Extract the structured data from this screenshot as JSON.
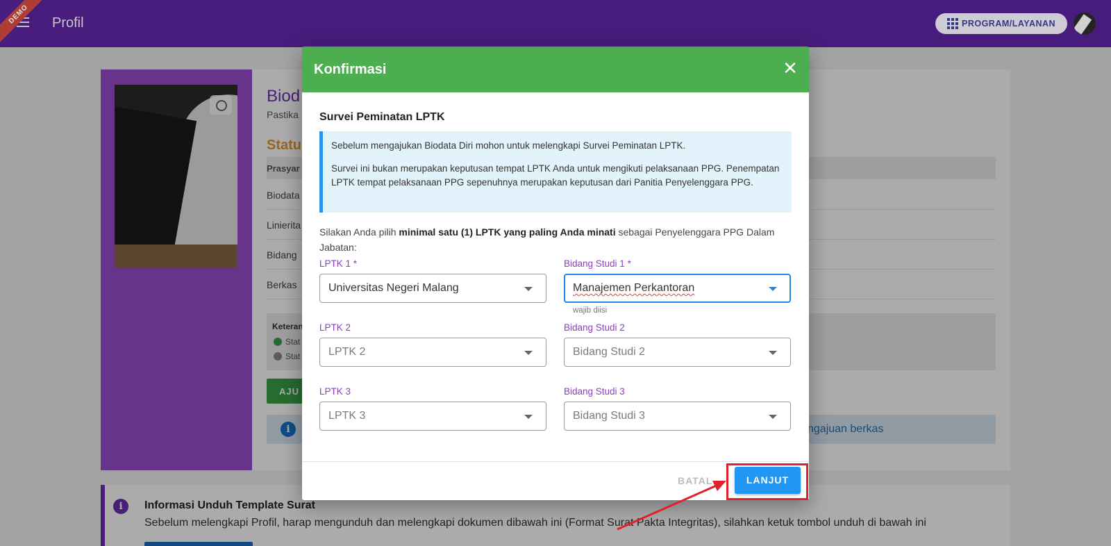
{
  "header": {
    "ribbon": "DEMO",
    "title": "Profil",
    "program_button": "PROGRAM/LAYANAN"
  },
  "background": {
    "title": "Biod",
    "subtitle": "Pastika",
    "status": "Statu",
    "table_header": "Prasyar",
    "rows": [
      "Biodata",
      "Linierita",
      "Bidang",
      "Berkas"
    ],
    "note_title": "Keteran",
    "note_lines": [
      "Stat",
      "Stat"
    ],
    "submit_button": "AJU",
    "info_link": "ngajuan berkas"
  },
  "info_card": {
    "title": "Informasi Unduh Template Surat",
    "text": "Sebelum melengkapi Profil, harap mengunduh dan melengkapi dokumen dibawah ini (Format Surat Pakta Integritas), silahkan ketuk tombol unduh di bawah ini"
  },
  "dialog": {
    "title": "Konfirmasi",
    "close_icon": "close-icon",
    "section_title": "Survei Peminatan LPTK",
    "alert_p1": "Sebelum mengajukan Biodata Diri mohon untuk melengkapi Survei Peminatan LPTK.",
    "alert_p2": "Survei ini bukan merupakan keputusan tempat LPTK Anda untuk mengikuti pelaksanaan PPG. Penempatan LPTK tempat pelaksanaan PPG sepenuhnya merupakan keputusan dari Panitia Penyelenggara PPG.",
    "instruction_pre": "Silakan Anda pilih ",
    "instruction_bold": "minimal satu (1) LPTK yang paling Anda minati",
    "instruction_post": " sebagai Penyelenggara PPG Dalam Jabatan:",
    "fields": [
      {
        "label": "LPTK 1 *",
        "value": "Universitas Negeri Malang",
        "placeholder": ""
      },
      {
        "label": "Bidang Studi 1 *",
        "value": "Manajemen Perkantoran",
        "placeholder": "",
        "hint": "wajib diisi"
      },
      {
        "label": "LPTK 2",
        "value": "",
        "placeholder": "LPTK 2"
      },
      {
        "label": "Bidang Studi 2",
        "value": "",
        "placeholder": "Bidang Studi 2"
      },
      {
        "label": "LPTK 3",
        "value": "",
        "placeholder": "LPTK 3"
      },
      {
        "label": "Bidang Studi 3",
        "value": "",
        "placeholder": "Bidang Studi 3"
      }
    ],
    "cancel_button": "BATAL",
    "next_button": "LANJUT"
  },
  "colors": {
    "header": "#52208e",
    "dialog_header": "#4cae4f",
    "primary_button": "#2196f3",
    "field_label": "#8e3cbe",
    "annotation": "#e0202a"
  }
}
